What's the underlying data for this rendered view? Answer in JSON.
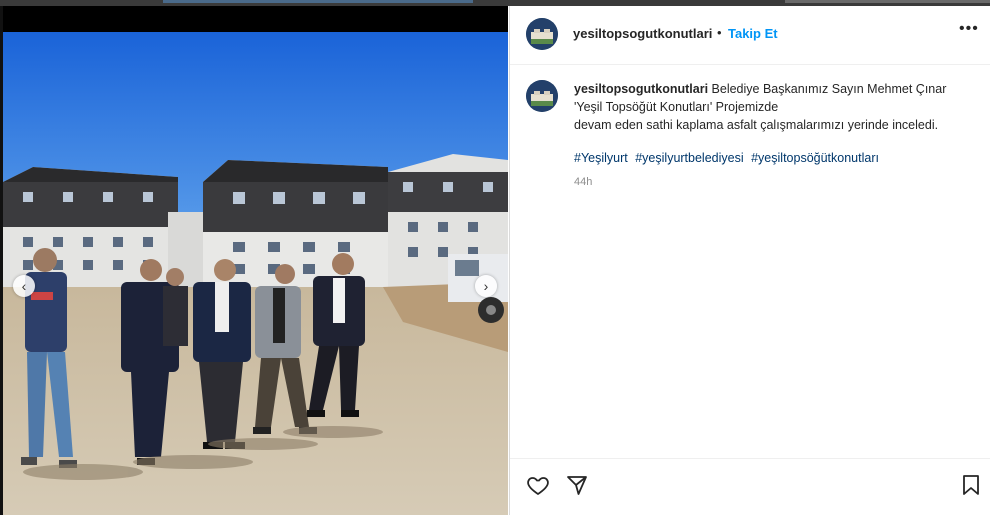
{
  "account": {
    "username": "yesiltopsogutkonutlari",
    "separator": "•",
    "follow_label": "Takip Et",
    "more_label": "•••"
  },
  "post": {
    "caption_line1": "Belediye Başkanımız Sayın Mehmet Çınar",
    "caption_line2": "'Yeşil Topsöğüt Konutları' Projemizde",
    "caption_line3": "devam eden sathi kaplama asfalt çalışmalarımızı yerinde inceledi.",
    "hashtags": [
      "#Yeşilyurt",
      "#yeşilyurtbelediyesi",
      "#yeşiltopsöğütkonutları"
    ],
    "time": "44h"
  },
  "carousel": {
    "prev_icon": "‹",
    "next_icon": "›"
  },
  "icons": {
    "like": "heart-icon",
    "share": "send-icon",
    "save": "bookmark-icon"
  },
  "colors": {
    "accent": "#0095f6",
    "hashtag": "#00376b",
    "muted": "#8e8e8e",
    "text": "#262626"
  }
}
